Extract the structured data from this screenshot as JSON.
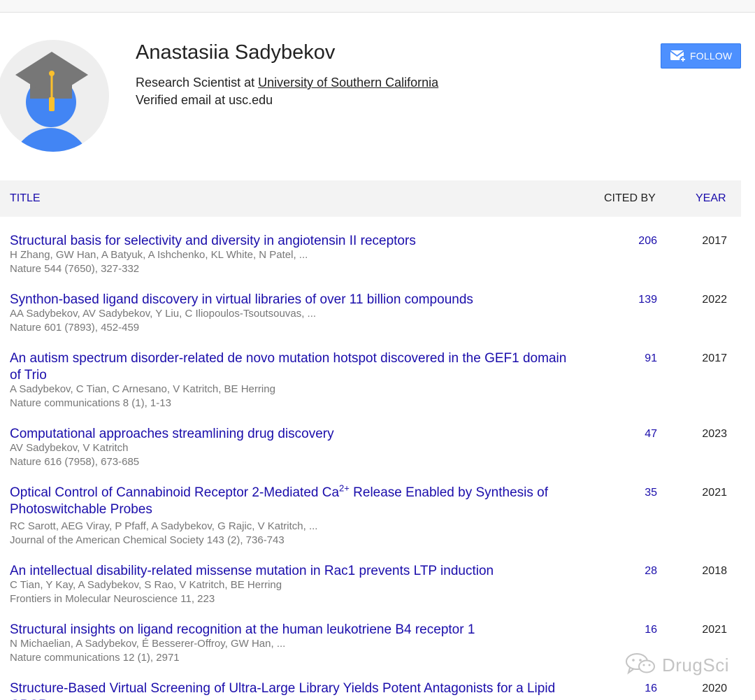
{
  "profile": {
    "name": "Anastasiia Sadybekov",
    "affiliation_prefix": "Research Scientist at ",
    "institution": "University of Southern California",
    "email": "Verified email at usc.edu",
    "follow_label": "FOLLOW",
    "avatar_icon": "graduation-cap-avatar-icon",
    "follow_icon": "envelope-plus-icon"
  },
  "table": {
    "header": {
      "title": "TITLE",
      "cited_by": "CITED BY",
      "year": "YEAR"
    },
    "rows": [
      {
        "title": "Structural basis for selectivity and diversity in angiotensin II receptors",
        "authors": "H Zhang, GW Han, A Batyuk, A Ishchenko, KL White, N Patel, ...",
        "venue": "Nature 544 (7650), 327-332",
        "cited_by": "206",
        "year": "2017"
      },
      {
        "title": "Synthon-based ligand discovery in virtual libraries of over 11 billion compounds",
        "authors": "AA Sadybekov, AV Sadybekov, Y Liu, C Iliopoulos-Tsoutsouvas, ...",
        "venue": "Nature 601 (7893), 452-459",
        "cited_by": "139",
        "year": "2022"
      },
      {
        "title": "An autism spectrum disorder-related de novo mutation hotspot discovered in the GEF1 domain of Trio",
        "authors": "A Sadybekov, C Tian, C Arnesano, V Katritch, BE Herring",
        "venue": "Nature communications 8 (1), 1-13",
        "cited_by": "91",
        "year": "2017"
      },
      {
        "title": "Computational approaches streamlining drug discovery",
        "authors": "AV Sadybekov, V Katritch",
        "venue": "Nature 616 (7958), 673-685",
        "cited_by": "47",
        "year": "2023"
      },
      {
        "title_a": "Optical Control of Cannabinoid Receptor 2-Mediated Ca",
        "title_sup": "2+",
        "title_b": " Release Enabled by Synthesis of Photoswitchable Probes",
        "authors": "RC Sarott, AEG Viray, P Pfaff, A Sadybekov, G Rajic, V Katritch, ...",
        "venue": "Journal of the American Chemical Society 143 (2), 736-743",
        "cited_by": "35",
        "year": "2021"
      },
      {
        "title": "An intellectual disability-related missense mutation in Rac1 prevents LTP induction",
        "authors": "C Tian, Y Kay, A Sadybekov, S Rao, V Katritch, BE Herring",
        "venue": "Frontiers in Molecular Neuroscience 11, 223",
        "cited_by": "28",
        "year": "2018"
      },
      {
        "title": "Structural insights on ligand recognition at the human leukotriene B4 receptor 1",
        "authors": "N Michaelian, A Sadybekov, É Besserer-Offroy, GW Han, ...",
        "venue": "Nature communications 12 (1), 2971",
        "cited_by": "16",
        "year": "2021"
      },
      {
        "title": "Structure-Based Virtual Screening of Ultra-Large Library Yields Potent Antagonists for a Lipid GPCR",
        "cited_by": "16",
        "year": "2020"
      }
    ]
  },
  "watermark": {
    "text": "DrugSci",
    "icon": "wechat-icon"
  }
}
